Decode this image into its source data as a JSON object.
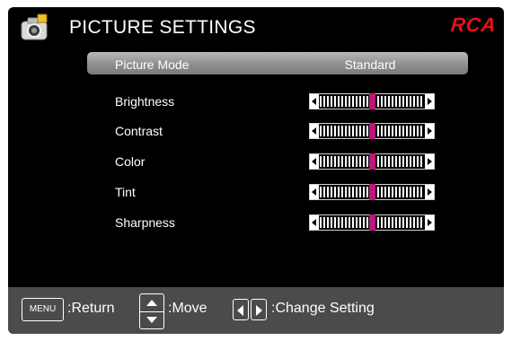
{
  "header": {
    "title": "PICTURE SETTINGS",
    "brand": "RCA",
    "icon": "picture-settings-icon"
  },
  "selected_row": {
    "label": "Picture Mode",
    "value": "Standard"
  },
  "settings": [
    {
      "label": "Brightness",
      "level": 0.5
    },
    {
      "label": "Contrast",
      "level": 0.5
    },
    {
      "label": "Color",
      "level": 0.5
    },
    {
      "label": "Tint",
      "level": 0.5
    },
    {
      "label": "Sharpness",
      "level": 0.5
    }
  ],
  "footer": {
    "menu_key": "MENU",
    "return_text": ":Return",
    "move_text": ":Move",
    "change_text": ":Change Setting"
  },
  "colors": {
    "accent": "#c2147c",
    "brand": "#e3121b",
    "footer_bg": "#4b4b4b"
  }
}
